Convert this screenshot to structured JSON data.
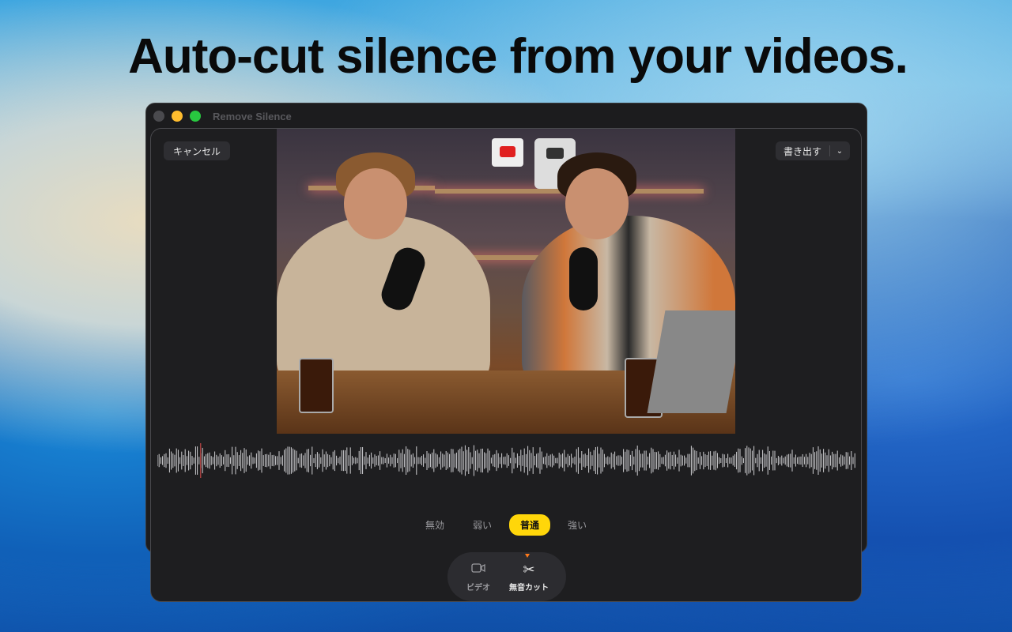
{
  "headline": "Auto-cut silence from your videos.",
  "window": {
    "title": "Remove Silence"
  },
  "toolbar": {
    "cancel_label": "キャンセル",
    "export_label": "書き出す"
  },
  "strength": {
    "options": [
      "無効",
      "弱い",
      "普通",
      "強い"
    ],
    "selected": "普通"
  },
  "dock": {
    "items": [
      {
        "label": "ビデオ",
        "icon": "video-icon"
      },
      {
        "label": "無音カット",
        "icon": "scissors-icon",
        "active": true
      }
    ]
  },
  "colors": {
    "accent": "#ffd60a",
    "indicator": "#ff7a1a",
    "playhead": "#e05050"
  },
  "playback": {
    "playhead_fraction": 0.062
  }
}
